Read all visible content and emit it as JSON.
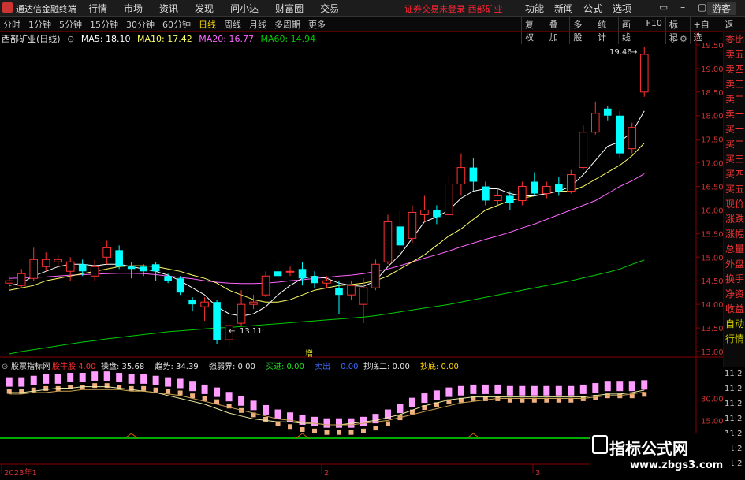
{
  "titlebar": {
    "app_title": "通达信金融终端",
    "menu": [
      "行情",
      "市场",
      "资讯",
      "发现",
      "问小达",
      "财富圈",
      "交易"
    ],
    "notice": "证券交易未登录  西部矿业",
    "right_menu": [
      "功能",
      "新闻",
      "公式",
      "选项"
    ],
    "window_controls": "▭ – ▢ ✕",
    "guest": "游客"
  },
  "toolbar": {
    "periods": [
      "分时",
      "1分钟",
      "5分钟",
      "15分钟",
      "30分钟",
      "60分钟",
      "日线",
      "周线",
      "月线",
      "多周期",
      "更多"
    ],
    "active_period": "日线",
    "tools": [
      "复权",
      "叠加",
      "多股",
      "统计",
      "画线",
      "F10",
      "标记",
      "+自选",
      "返回"
    ]
  },
  "chart_info": {
    "title": "西部矿业(日线)",
    "ma5": "MA5: 18.10",
    "ma10": "MA10: 17.42",
    "ma20": "MA20: 16.77",
    "ma60": "MA60: 14.94"
  },
  "indicator_info": {
    "name": "股票指标网",
    "items": [
      {
        "label": "股牛股",
        "value": "4.00",
        "color": "#ff3030"
      },
      {
        "label": "操盘:",
        "value": "35.68",
        "color": "#e8e8e8"
      },
      {
        "label": "趋势:",
        "value": "34.39",
        "color": "#e8e8e8"
      },
      {
        "label": "强弱界:",
        "value": "0.00",
        "color": "#e8e8e8"
      },
      {
        "label": "买进:",
        "value": "0.00",
        "color": "#20e020"
      },
      {
        "label": "卖出—",
        "value": "0.00",
        "color": "#3a6cff"
      },
      {
        "label": "抄底二:",
        "value": "0.00",
        "color": "#e8e8e8"
      },
      {
        "label": "抄底:",
        "value": "0.00",
        "color": "#ffd700"
      }
    ]
  },
  "price_axis": [
    "19.50",
    "19.00",
    "18.50",
    "18.00",
    "17.50",
    "17.00",
    "16.50",
    "16.00",
    "15.50",
    "15.00",
    "14.50",
    "14.00",
    "13.50",
    "13.00"
  ],
  "time_axis": [
    "2023年1",
    "2",
    "3"
  ],
  "indicator_axis": [
    "30.00",
    "15.00"
  ],
  "annotations": {
    "high": "19.46",
    "low": "13.11",
    "zeng": "增"
  },
  "right_panel": [
    "委比",
    "卖五",
    "卖四",
    "卖三",
    "卖二",
    "卖一",
    "买一",
    "买二",
    "买三",
    "买四",
    "买五",
    "现价",
    "涨跌",
    "涨幅",
    "总量",
    "外盘",
    "换手",
    "净资",
    "收益",
    "自动",
    "行情"
  ],
  "right_time_axis": [
    "11:2",
    "11:2",
    "11:2",
    "11:2",
    "11:2",
    "11:2",
    "11:2",
    "11:2"
  ],
  "watermark": {
    "line1": "指标公式网",
    "line2": "www.zbgs3.com"
  },
  "colors": {
    "up": "#ff3232",
    "down": "#00ffff",
    "ma5": "#ffffff",
    "ma10": "#ffff64",
    "ma20": "#ff64ff",
    "ma60": "#00cc00"
  },
  "chart_data": {
    "type": "candlestick",
    "title": "西部矿业(日线)",
    "ylim": [
      12.9,
      19.75
    ],
    "candles": [
      [
        14.45,
        14.5,
        14.6,
        14.3
      ],
      [
        14.4,
        14.65,
        14.75,
        14.35
      ],
      [
        14.55,
        14.95,
        15.2,
        14.5
      ],
      [
        14.8,
        14.95,
        15.1,
        14.7
      ],
      [
        14.9,
        14.95,
        15.05,
        14.8
      ],
      [
        14.7,
        14.9,
        15.0,
        14.5
      ],
      [
        14.85,
        14.7,
        14.95,
        14.6
      ],
      [
        14.6,
        14.8,
        14.95,
        14.5
      ],
      [
        15.0,
        15.2,
        15.35,
        14.85
      ],
      [
        15.15,
        14.8,
        15.25,
        14.75
      ],
      [
        14.8,
        14.75,
        14.9,
        14.55
      ],
      [
        14.8,
        14.7,
        14.85,
        14.6
      ],
      [
        14.85,
        14.7,
        14.9,
        14.5
      ],
      [
        14.6,
        14.5,
        14.65,
        14.45
      ],
      [
        14.55,
        14.25,
        14.6,
        14.2
      ],
      [
        14.1,
        14.0,
        14.15,
        13.85
      ],
      [
        13.95,
        14.05,
        14.15,
        13.65
      ],
      [
        14.05,
        13.25,
        14.1,
        13.15
      ],
      [
        13.25,
        13.55,
        13.6,
        13.1
      ],
      [
        13.6,
        14.0,
        14.3,
        13.55
      ],
      [
        14.0,
        14.05,
        14.2,
        13.9
      ],
      [
        14.2,
        14.6,
        14.7,
        14.15
      ],
      [
        14.7,
        14.6,
        14.9,
        14.5
      ],
      [
        14.7,
        14.7,
        14.8,
        14.6
      ],
      [
        14.75,
        14.55,
        14.9,
        14.4
      ],
      [
        14.6,
        14.45,
        14.7,
        14.35
      ],
      [
        14.45,
        14.5,
        14.6,
        14.35
      ],
      [
        14.35,
        14.2,
        14.5,
        13.8
      ],
      [
        14.2,
        14.4,
        14.5,
        14.1
      ],
      [
        14.0,
        14.35,
        14.55,
        13.6
      ],
      [
        14.35,
        14.85,
        14.95,
        14.3
      ],
      [
        14.9,
        15.75,
        15.9,
        14.85
      ],
      [
        15.65,
        15.25,
        16.0,
        15.0
      ],
      [
        15.4,
        15.95,
        16.1,
        15.3
      ],
      [
        15.9,
        16.0,
        16.3,
        15.75
      ],
      [
        16.0,
        15.85,
        16.1,
        15.7
      ],
      [
        15.9,
        16.55,
        16.7,
        15.85
      ],
      [
        16.55,
        16.9,
        17.2,
        16.3
      ],
      [
        16.9,
        16.6,
        17.1,
        16.4
      ],
      [
        16.5,
        16.2,
        16.6,
        16.1
      ],
      [
        16.2,
        16.3,
        16.45,
        16.1
      ],
      [
        16.3,
        16.15,
        16.4,
        16.0
      ],
      [
        16.2,
        16.5,
        16.6,
        16.1
      ],
      [
        16.6,
        16.35,
        16.8,
        16.3
      ],
      [
        16.35,
        16.5,
        16.6,
        16.25
      ],
      [
        16.55,
        16.4,
        16.7,
        16.3
      ],
      [
        16.4,
        16.75,
        16.85,
        16.35
      ],
      [
        16.9,
        17.65,
        17.8,
        16.85
      ],
      [
        17.65,
        18.05,
        18.3,
        17.6
      ],
      [
        18.15,
        18.0,
        18.2,
        17.9
      ],
      [
        18.0,
        17.2,
        18.1,
        17.1
      ],
      [
        17.3,
        17.75,
        17.85,
        17.2
      ],
      [
        18.5,
        19.3,
        19.46,
        18.4
      ]
    ],
    "ma5": [
      14.4,
      14.45,
      14.6,
      14.7,
      14.8,
      14.85,
      14.85,
      14.82,
      14.85,
      14.85,
      14.8,
      14.75,
      14.7,
      14.62,
      14.5,
      14.35,
      14.2,
      13.95,
      13.8,
      13.75,
      13.8,
      13.95,
      14.2,
      14.4,
      14.55,
      14.6,
      14.55,
      14.45,
      14.4,
      14.38,
      14.5,
      14.8,
      15.05,
      15.4,
      15.75,
      15.85,
      16.0,
      16.25,
      16.4,
      16.45,
      16.45,
      16.35,
      16.3,
      16.3,
      16.35,
      16.4,
      16.5,
      16.75,
      17.05,
      17.35,
      17.45,
      17.65,
      18.1
    ],
    "ma10": [
      14.3,
      14.35,
      14.4,
      14.5,
      14.55,
      14.6,
      14.65,
      14.7,
      14.75,
      14.8,
      14.82,
      14.82,
      14.8,
      14.75,
      14.7,
      14.62,
      14.55,
      14.45,
      14.3,
      14.2,
      14.1,
      14.05,
      14.05,
      14.1,
      14.2,
      14.3,
      14.35,
      14.4,
      14.42,
      14.45,
      14.5,
      14.6,
      14.75,
      14.9,
      15.05,
      15.25,
      15.45,
      15.6,
      15.8,
      16.0,
      16.1,
      16.2,
      16.25,
      16.3,
      16.35,
      16.4,
      16.4,
      16.5,
      16.65,
      16.8,
      16.95,
      17.15,
      17.42
    ],
    "ma20": [
      14.55,
      14.56,
      14.57,
      14.58,
      14.6,
      14.62,
      14.63,
      14.64,
      14.65,
      14.66,
      14.66,
      14.65,
      14.63,
      14.6,
      14.57,
      14.54,
      14.5,
      14.47,
      14.45,
      14.44,
      14.44,
      14.45,
      14.47,
      14.5,
      14.52,
      14.55,
      14.57,
      14.6,
      14.62,
      14.65,
      14.7,
      14.75,
      14.82,
      14.9,
      14.98,
      15.05,
      15.13,
      15.22,
      15.3,
      15.38,
      15.45,
      15.53,
      15.62,
      15.7,
      15.8,
      15.9,
      16.0,
      16.1,
      16.2,
      16.35,
      16.5,
      16.62,
      16.77
    ],
    "ma60": [
      12.95,
      13.0,
      13.04,
      13.08,
      13.12,
      13.16,
      13.2,
      13.23,
      13.27,
      13.3,
      13.33,
      13.36,
      13.39,
      13.42,
      13.44,
      13.46,
      13.48,
      13.5,
      13.51,
      13.53,
      13.55,
      13.57,
      13.59,
      13.61,
      13.63,
      13.65,
      13.67,
      13.69,
      13.71,
      13.73,
      13.76,
      13.8,
      13.84,
      13.88,
      13.92,
      13.96,
      14.0,
      14.05,
      14.1,
      14.15,
      14.2,
      14.25,
      14.3,
      14.35,
      14.4,
      14.45,
      14.5,
      14.56,
      14.62,
      14.68,
      14.75,
      14.85,
      14.94
    ],
    "indicator": {
      "ylim": [
        5,
        48
      ],
      "bars": [
        38,
        38,
        39,
        40,
        40,
        41,
        41,
        42,
        42,
        41,
        40,
        40,
        39,
        38,
        37,
        35,
        33,
        31,
        28,
        25,
        22,
        19,
        16,
        14,
        12,
        11,
        10,
        10,
        10,
        11,
        13,
        16,
        20,
        24,
        27,
        29,
        31,
        32,
        33,
        33,
        33,
        32,
        32,
        32,
        32,
        32,
        32,
        33,
        34,
        35,
        35,
        35,
        36
      ],
      "operate": [
        34,
        34,
        35,
        36,
        37,
        37,
        38,
        38,
        38,
        37,
        36,
        35,
        34,
        32,
        30,
        28,
        26,
        23,
        20,
        18,
        16,
        15,
        14,
        14,
        13,
        13,
        12,
        12,
        13,
        14,
        15,
        17,
        19,
        22,
        25,
        27,
        29,
        30,
        31,
        31,
        31,
        31,
        31,
        31,
        31,
        31,
        31,
        31,
        32,
        33,
        33,
        34,
        35.68
      ],
      "trend": [
        33,
        33,
        34,
        34,
        35,
        35,
        36,
        36,
        36,
        36,
        35,
        35,
        34,
        33,
        32,
        30,
        28,
        26,
        24,
        22,
        20,
        18,
        16,
        15,
        14,
        13,
        12,
        12,
        12,
        13,
        14,
        15,
        17,
        19,
        21,
        23,
        25,
        27,
        28,
        29,
        30,
        30,
        30,
        30,
        30,
        30,
        30,
        30,
        31,
        32,
        32,
        33,
        34.39
      ]
    }
  }
}
